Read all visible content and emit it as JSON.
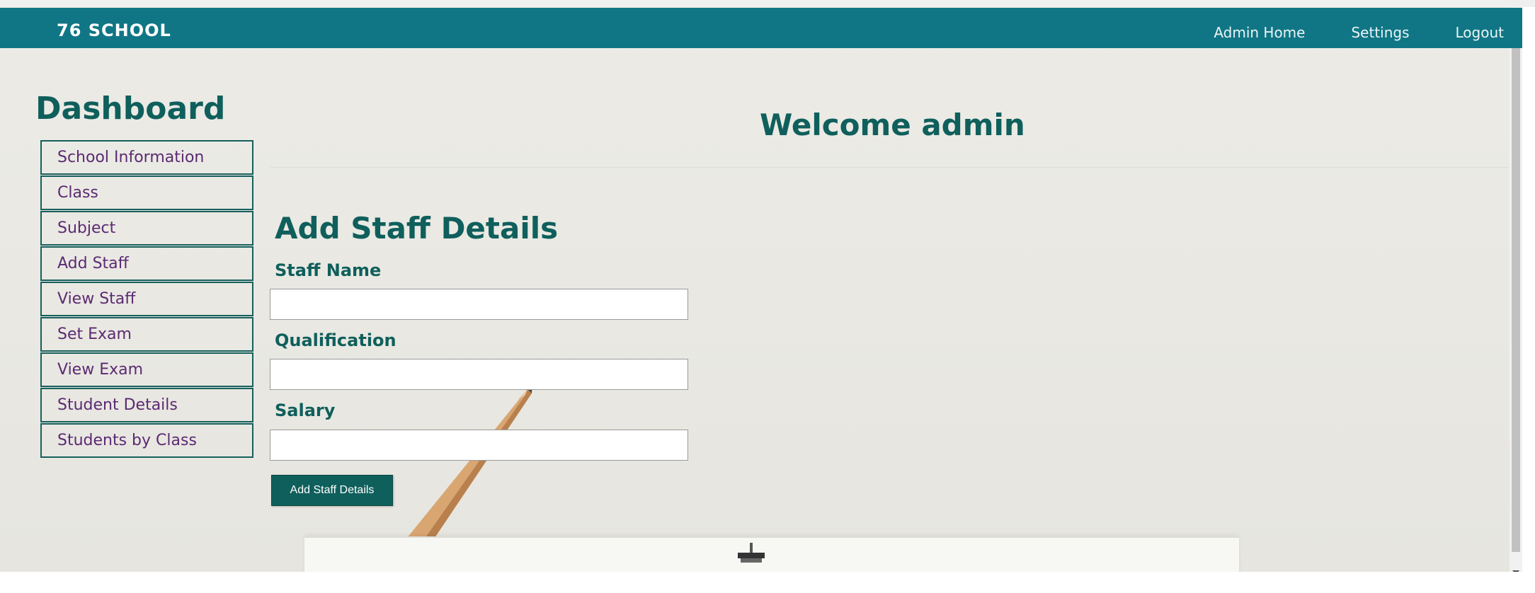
{
  "navbar": {
    "brand": "76 SCHOOL",
    "links": [
      "Admin Home",
      "Settings",
      "Logout"
    ]
  },
  "sidebar": {
    "title": "Dashboard",
    "items": [
      "School Information",
      "Class",
      "Subject",
      "Add Staff",
      "View Staff",
      "Set Exam",
      "View Exam",
      "Student Details",
      "Students by Class"
    ]
  },
  "main": {
    "welcome": "Welcome admin",
    "form": {
      "title": "Add Staff Details",
      "fields": [
        {
          "label": "Staff Name",
          "value": ""
        },
        {
          "label": "Qualification",
          "value": ""
        },
        {
          "label": "Salary",
          "value": ""
        }
      ],
      "submit_label": "Add Staff Details"
    }
  },
  "colors": {
    "navbar": "#107685",
    "accent": "#0f5f5c",
    "sidebar_text": "#5b2a72"
  }
}
